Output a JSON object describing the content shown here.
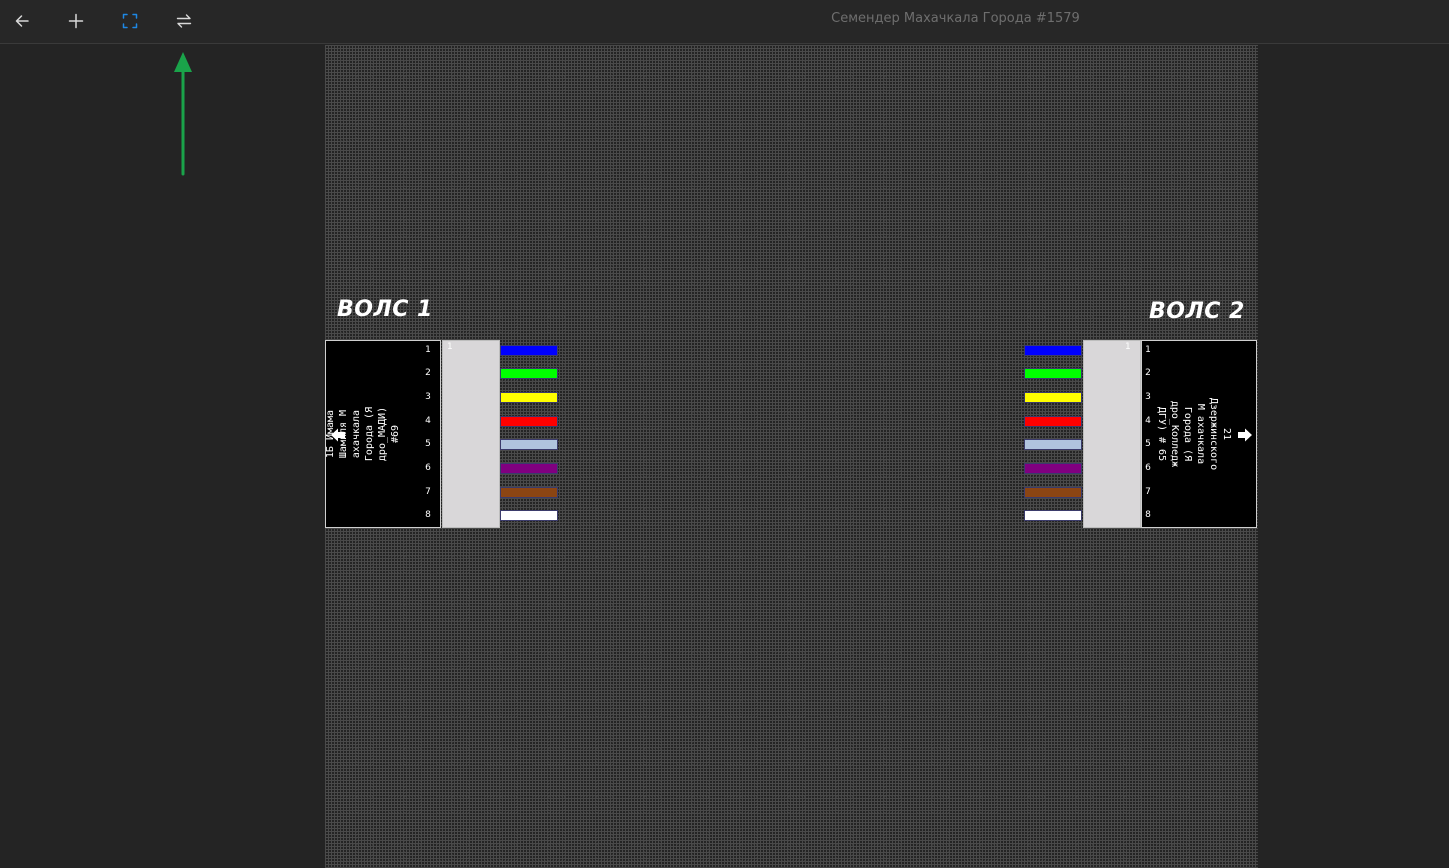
{
  "window": {
    "title": "Семендер Махачкала Города #1579"
  },
  "toolbar": {
    "back": {
      "icon": "arrow-left-icon"
    },
    "add": {
      "icon": "plus-icon"
    },
    "fit": {
      "icon": "fit-screen-icon"
    },
    "swap": {
      "icon": "swap-icon"
    }
  },
  "colors": {
    "accent": "#1e88e5",
    "hint_arrow": "#1aa34a",
    "fiber_1": "#0000ff",
    "fiber_2": "#00ff00",
    "fiber_3": "#ffff00",
    "fiber_4": "#ff0000",
    "fiber_5": "#b0c4de",
    "fiber_6": "#800080",
    "fiber_7": "#8b4513",
    "fiber_8": "#ffffff"
  },
  "cables": [
    {
      "label": "ВОЛС 1",
      "name": "1Б Имама Шамиля М ахачкала Города (Я дро_МАДИ) #69",
      "direction_icon": "arrow-left-icon",
      "splitter_number": "1",
      "fibers": [
        "1",
        "2",
        "3",
        "4",
        "5",
        "6",
        "7",
        "8"
      ]
    },
    {
      "label": "ВОЛС 2",
      "name": "21 Дзержинского М ахачкала Города (Я дро_Колледж ДГУ) # 65",
      "direction_icon": "arrow-right-icon",
      "splitter_number": "1",
      "fibers": [
        "1",
        "2",
        "3",
        "4",
        "5",
        "6",
        "7",
        "8"
      ]
    }
  ]
}
